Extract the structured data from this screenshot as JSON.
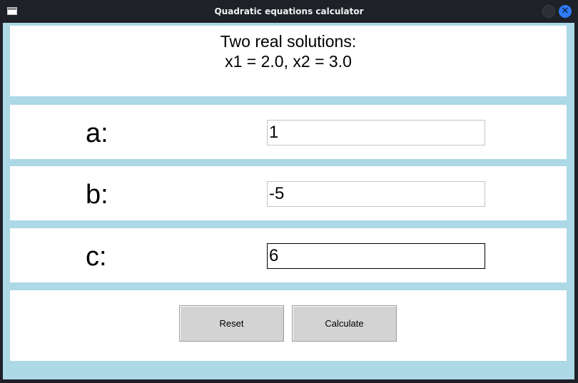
{
  "window": {
    "title": "Quadratic equations calculator",
    "close_glyph": "✕"
  },
  "result": {
    "line1": "Two real solutions:",
    "line2": "x1 = 2.0, x2 = 3.0"
  },
  "fields": {
    "a": {
      "label": "a:",
      "value": "1"
    },
    "b": {
      "label": "b:",
      "value": "-5"
    },
    "c": {
      "label": "c:",
      "value": "6"
    }
  },
  "buttons": {
    "reset": "Reset",
    "calculate": "Calculate"
  },
  "colors": {
    "background": "#add8e6",
    "panel": "#ffffff",
    "button": "#d3d3d3",
    "titlebar": "#1e2128",
    "close_accent": "#2f7cf6"
  },
  "icons": {
    "app": "app-window-icon",
    "minimize": "minimize-icon",
    "close": "close-icon"
  }
}
